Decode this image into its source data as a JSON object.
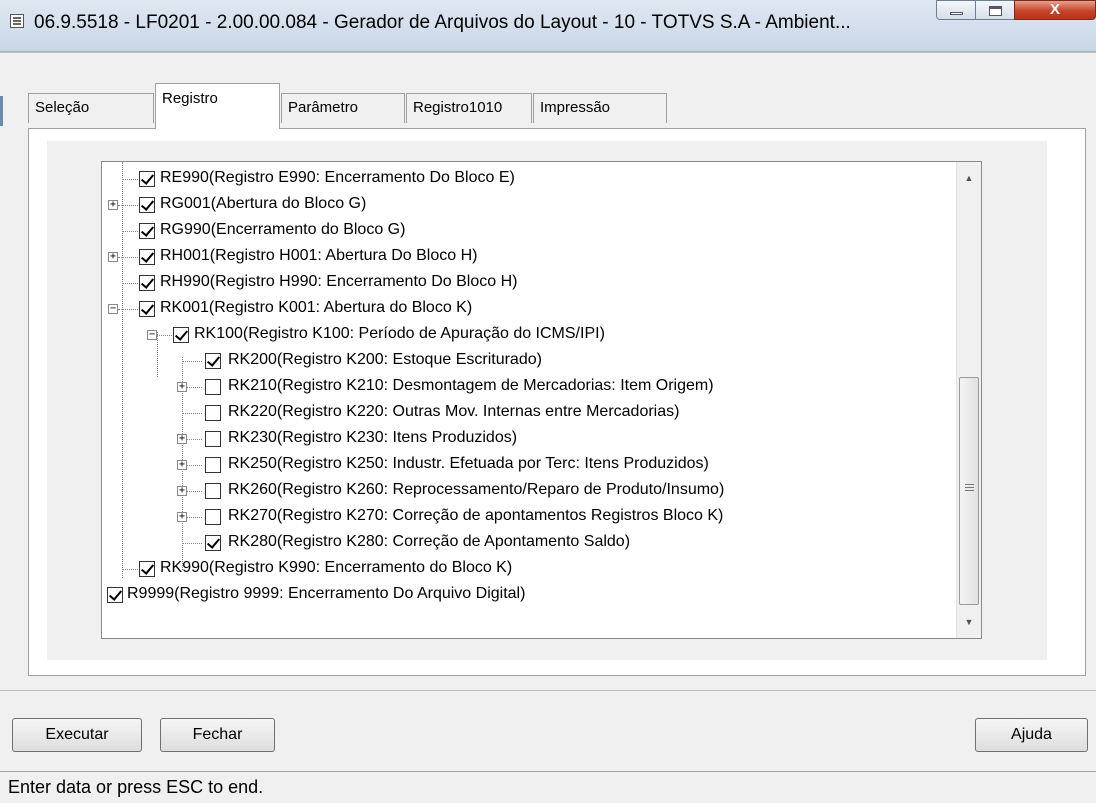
{
  "window": {
    "title": "06.9.5518 - LF0201 - 2.00.00.084 - Gerador de Arquivos do Layout - 10 - TOTVS S.A - Ambient...",
    "close_glyph": "X"
  },
  "tabs": [
    {
      "label": "Seleção"
    },
    {
      "label": "Registro"
    },
    {
      "label": "Parâmetro"
    },
    {
      "label": "Registro1010"
    },
    {
      "label": "Impressão"
    }
  ],
  "tree": {
    "items": [
      {
        "label": "RE990(Registro E990: Encerramento Do Bloco E)",
        "checked": true,
        "expander": "none"
      },
      {
        "label": "RG001(Abertura do Bloco G)",
        "checked": true,
        "expander": "plus"
      },
      {
        "label": "RG990(Encerramento do Bloco G)",
        "checked": true,
        "expander": "none"
      },
      {
        "label": "RH001(Registro H001: Abertura Do Bloco H)",
        "checked": true,
        "expander": "plus"
      },
      {
        "label": "RH990(Registro H990: Encerramento Do Bloco H)",
        "checked": true,
        "expander": "none"
      },
      {
        "label": "RK001(Registro K001: Abertura do Bloco K)",
        "checked": true,
        "expander": "minus"
      },
      {
        "label": "RK100(Registro K100: Período de Apuração do ICMS/IPI)",
        "checked": true,
        "expander": "minus"
      },
      {
        "label": "RK200(Registro K200: Estoque Escriturado)",
        "checked": true,
        "expander": "none"
      },
      {
        "label": "RK210(Registro K210: Desmontagem de Mercadorias: Item Origem)",
        "checked": false,
        "expander": "plus"
      },
      {
        "label": "RK220(Registro K220: Outras Mov. Internas entre Mercadorias)",
        "checked": false,
        "expander": "none"
      },
      {
        "label": "RK230(Registro K230: Itens Produzidos)",
        "checked": false,
        "expander": "plus"
      },
      {
        "label": "RK250(Registro K250: Industr. Efetuada por Terc: Itens Produzidos)",
        "checked": false,
        "expander": "plus"
      },
      {
        "label": "RK260(Registro K260: Reprocessamento/Reparo de Produto/Insumo)",
        "checked": false,
        "expander": "plus"
      },
      {
        "label": "RK270(Registro K270: Correção de apontamentos Registros Bloco K)",
        "checked": false,
        "expander": "plus"
      },
      {
        "label": "RK280(Registro K280: Correção de Apontamento Saldo)",
        "checked": true,
        "expander": "none"
      },
      {
        "label": "RK990(Registro K990: Encerramento do Bloco K)",
        "checked": true,
        "expander": "none"
      },
      {
        "label": "R9999(Registro 9999: Encerramento Do Arquivo Digital)",
        "checked": true,
        "expander": "none"
      }
    ]
  },
  "buttons": {
    "execute": "Executar",
    "close": "Fechar",
    "help": "Ajuda"
  },
  "status": {
    "text": "Enter data or press ESC to end."
  },
  "icons": {
    "app": "window-app-icon",
    "minimize": "minimize-icon",
    "maximize": "maximize-icon",
    "close": "close-icon",
    "scroll_up": "scroll-up-arrow-icon",
    "scroll_down": "scroll-down-arrow-icon"
  }
}
